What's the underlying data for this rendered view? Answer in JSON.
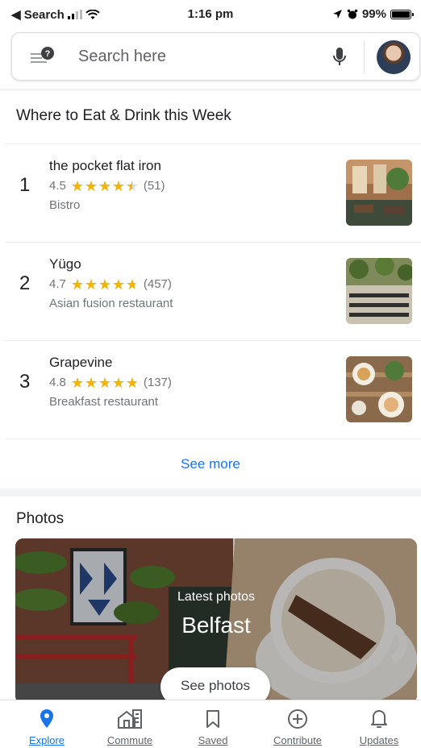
{
  "status_bar": {
    "back_label": "◀ Search",
    "time": "1:16 pm",
    "battery": "99%",
    "battery_level": 0.99
  },
  "search": {
    "placeholder": "Search here",
    "icons": [
      "menu-help-icon",
      "mic-icon",
      "avatar"
    ]
  },
  "eat_drink": {
    "title": "Where to Eat & Drink this Week",
    "places": [
      {
        "rank": "1",
        "name": "the pocket flat iron",
        "rating": "4.5",
        "rating_value": 4.5,
        "reviews": "(51)",
        "category": "Bistro"
      },
      {
        "rank": "2",
        "name": "Yügo",
        "rating": "4.7",
        "rating_value": 4.7,
        "reviews": "(457)",
        "category": "Asian fusion restaurant"
      },
      {
        "rank": "3",
        "name": "Grapevine",
        "rating": "4.8",
        "rating_value": 4.8,
        "reviews": "(137)",
        "category": "Breakfast restaurant"
      }
    ],
    "see_more": "See more"
  },
  "photos": {
    "title": "Photos",
    "latest_label": "Latest photos",
    "city": "Belfast",
    "button": "See photos"
  },
  "bottom_nav": {
    "items": [
      {
        "label": "Explore",
        "icon": "location-pin-icon",
        "active": true
      },
      {
        "label": "Commute",
        "icon": "commute-icon",
        "active": false
      },
      {
        "label": "Saved",
        "icon": "bookmark-icon",
        "active": false
      },
      {
        "label": "Contribute",
        "icon": "add-circle-icon",
        "active": false
      },
      {
        "label": "Updates",
        "icon": "bell-icon",
        "active": false
      }
    ]
  },
  "colors": {
    "accent": "#1a73e8",
    "star": "#f4b400",
    "secondary_text": "#70757a"
  }
}
